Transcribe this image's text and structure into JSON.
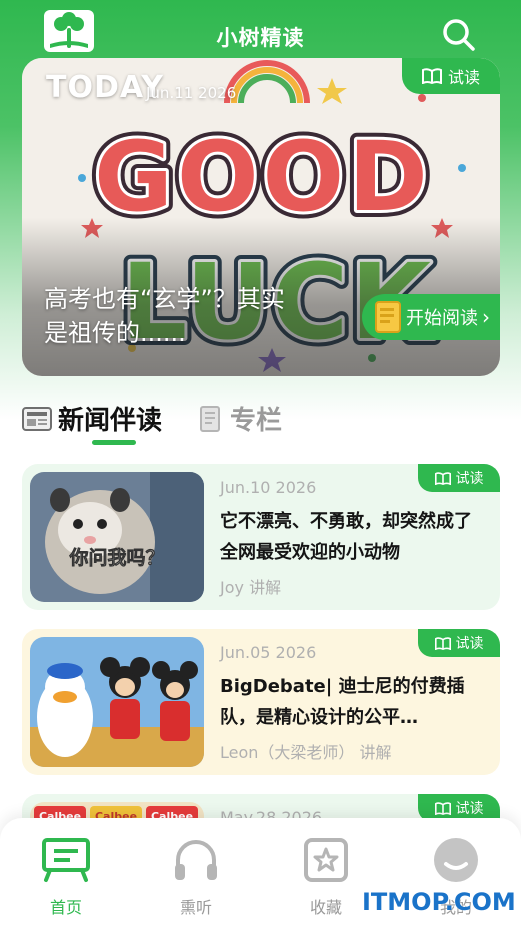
{
  "header": {
    "title": "小树精读",
    "logo_icon": "tree-book-logo-icon",
    "search_icon": "search-icon"
  },
  "hero": {
    "today": "TODAY",
    "date": "Jun.11 2026",
    "trial_label": "试读",
    "caption_line1": "高考也有“玄学”？其实",
    "caption_line2": "是祖传的......",
    "start_label": "开始阅读",
    "art_text_1": "GOOD",
    "art_text_2": "LUCK"
  },
  "tabs": {
    "news": "新闻伴读",
    "column": "专栏"
  },
  "articles": [
    {
      "date": "Jun.10 2026",
      "title": "它不漂亮、不勇敢，却突然成了全网最受欢迎的小动物",
      "author": "Joy 讲解",
      "trial_label": "试读",
      "thumb_text": "你问我吗？"
    },
    {
      "date": "Jun.05 2026",
      "title": "BigDebate| 迪士尼的付费插队，是精心设计的公平…",
      "author": "Leon（大梁老师） 讲解",
      "trial_label": "试读"
    },
    {
      "date": "May.28 2026",
      "trial_label": "试读",
      "thumb_text": "Calbee"
    }
  ],
  "nav": {
    "home": "首页",
    "listen": "熏听",
    "favorites": "收藏",
    "me": "我的"
  },
  "watermark": "ITMOP.COM",
  "colors": {
    "brand_green": "#2fb84f",
    "card_green_bg": "#ecf8ee",
    "card_yellow_bg": "#fdf6df",
    "watermark_blue": "#1a73c9"
  }
}
